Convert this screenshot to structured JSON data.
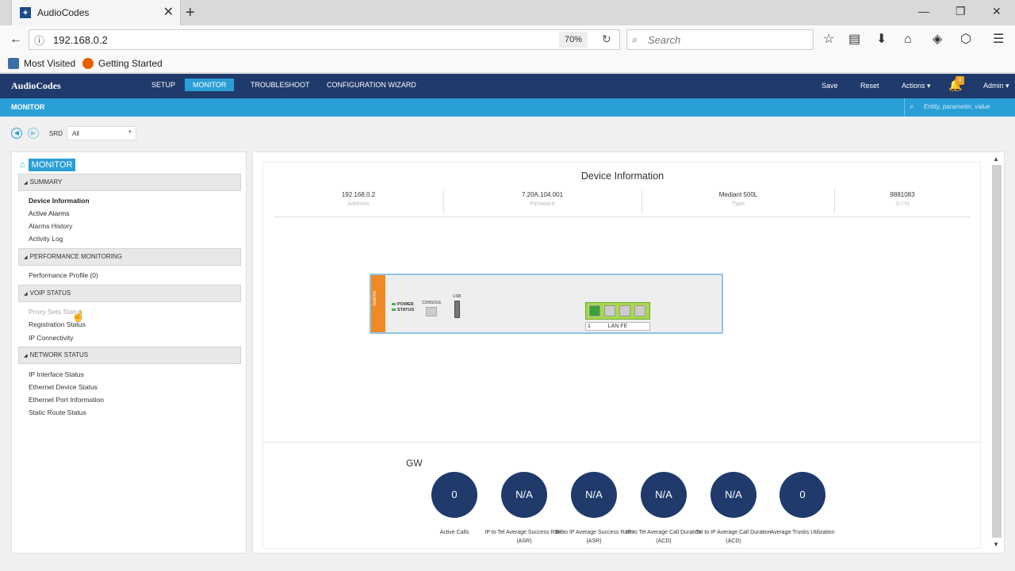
{
  "browser": {
    "tab_title": "AudioCodes",
    "url": "192.168.0.2",
    "zoom": "70%",
    "search_placeholder": "Search",
    "bookmarks": [
      "Most Visited",
      "Getting Started"
    ]
  },
  "header": {
    "logo": "AudioCodes",
    "nav": [
      "SETUP",
      "MONITOR",
      "TROUBLESHOOT",
      "CONFIGURATION WIZARD"
    ],
    "active_nav": "MONITOR",
    "save": "Save",
    "reset": "Reset",
    "actions": "Actions ▾",
    "alerts_count": "4",
    "user": "Admin ▾"
  },
  "subheader": {
    "title": "MONITOR",
    "search_placeholder": "Entity, parameter, value"
  },
  "srd": {
    "label": "SRD",
    "value": "All"
  },
  "sidebar": {
    "root": "MONITOR",
    "sections": [
      {
        "title": "SUMMARY",
        "items": [
          "Device Information",
          "Active Alarms",
          "Alarms History",
          "Activity Log"
        ]
      },
      {
        "title": "PERFORMANCE MONITORING",
        "items": [
          "Performance Profile (0)"
        ]
      },
      {
        "title": "VOIP STATUS",
        "items": [
          "Proxy Sets Status",
          "Registration Status",
          "IP Connectivity"
        ]
      },
      {
        "title": "NETWORK STATUS",
        "items": [
          "IP Interface Status",
          "Ethernet Device Status",
          "Ethernet Port Information",
          "Static Route Status"
        ]
      }
    ]
  },
  "device_info": {
    "title": "Device Information",
    "columns": [
      {
        "value": "192.168.0.2",
        "label": "Address"
      },
      {
        "value": "7.20A.104.001",
        "label": "Firmware"
      },
      {
        "value": "Mediant 500L",
        "label": "Type"
      },
      {
        "value": "9881083",
        "label": "S / N"
      }
    ]
  },
  "device_panel": {
    "alarms": "Alarms",
    "power": "POWER",
    "status": "STATUS",
    "console": "CONSOLE",
    "usb": "USB",
    "lan_num": "1",
    "lan_label": "LAN FE"
  },
  "gw": {
    "label": "GW",
    "kpis": [
      {
        "value": "0",
        "label": "Active Calls"
      },
      {
        "value": "N/A",
        "label": "IP to Tel Average Success Ratio (ASR)"
      },
      {
        "value": "N/A",
        "label": "Tel to IP Average Success Ratio (ASR)"
      },
      {
        "value": "N/A",
        "label": "IP to Tel Average Call Duration (ACD)"
      },
      {
        "value": "N/A",
        "label": "Tel to IP Average Call Duration (ACD)"
      },
      {
        "value": "0",
        "label": "Average Trunks Utilization"
      }
    ]
  }
}
